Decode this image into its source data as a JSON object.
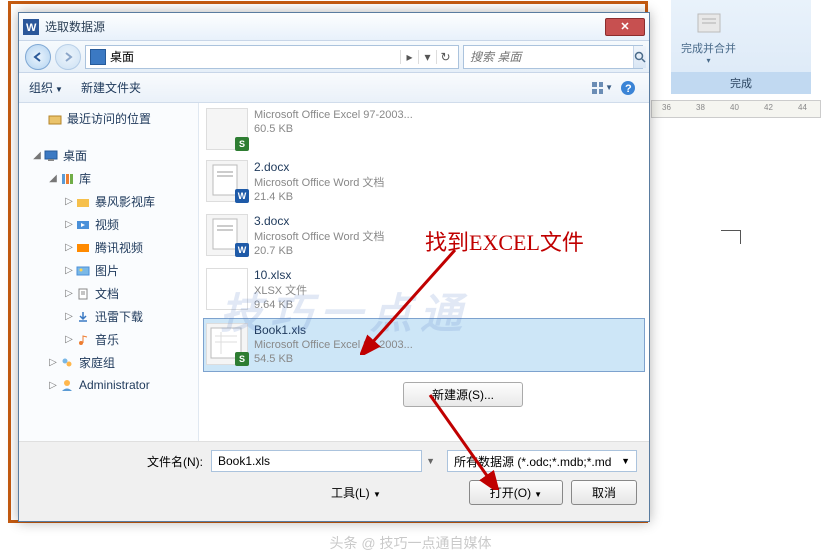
{
  "dialog": {
    "title": "选取数据源",
    "location": "桌面",
    "search_placeholder": "搜索 桌面",
    "toolbar": {
      "organize": "组织",
      "new_folder": "新建文件夹"
    },
    "sidebar": {
      "recent": "最近访问的位置",
      "desktop": "桌面",
      "libraries": "库",
      "lib_items": {
        "baofeng": "暴风影视库",
        "video": "视频",
        "tencent": "腾讯视频",
        "pictures": "图片",
        "documents": "文档",
        "xunlei": "迅雷下载",
        "music": "音乐"
      },
      "homegroup": "家庭组",
      "admin": "Administrator"
    },
    "files": [
      {
        "name": "",
        "meta": "Microsoft Office Excel 97-2003...",
        "size": "60.5 KB",
        "type": "xls"
      },
      {
        "name": "2.docx",
        "meta": "Microsoft Office Word 文档",
        "size": "21.4 KB",
        "type": "doc"
      },
      {
        "name": "3.docx",
        "meta": "Microsoft Office Word 文档",
        "size": "20.7 KB",
        "type": "doc"
      },
      {
        "name": "10.xlsx",
        "meta": "XLSX 文件",
        "size": "9.64 KB",
        "type": "blank"
      },
      {
        "name": "Book1.xls",
        "meta": "Microsoft Office Excel 97-2003...",
        "size": "54.5 KB",
        "type": "xls"
      }
    ],
    "new_source": "新建源(S)...",
    "filename_label": "文件名(N):",
    "filename_value": "Book1.xls",
    "filter": "所有数据源 (*.odc;*.mdb;*.md",
    "tools": "工具(L)",
    "open": "打开(O)",
    "cancel": "取消"
  },
  "ribbon": {
    "finish_merge": "完成并合并",
    "finish": "完成"
  },
  "ruler": {
    "t36": "36",
    "t38": "38",
    "t40": "40",
    "t42": "42",
    "t44": "44"
  },
  "annotations": {
    "find_excel": "找到EXCEL文件"
  },
  "watermarks": {
    "bottom": "头条 @ 技巧一点通自媒体",
    "mid": "技巧一点通"
  }
}
